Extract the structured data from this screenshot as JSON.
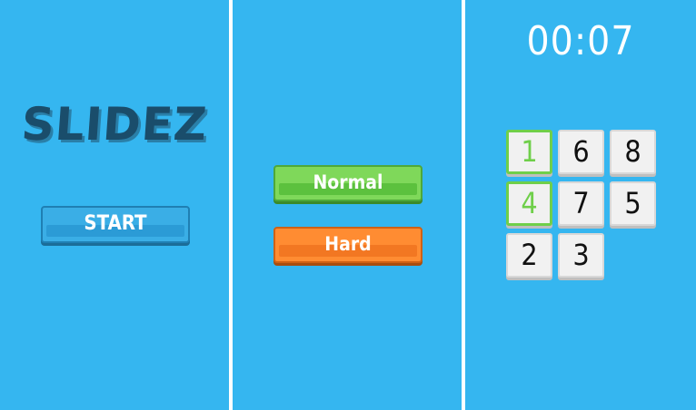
{
  "title_screen": {
    "logo": "SLIDEZ",
    "start_label": "START"
  },
  "difficulty_screen": {
    "normal_label": "Normal",
    "hard_label": "Hard"
  },
  "game_screen": {
    "timer": "00:07",
    "tiles": [
      {
        "label": "1",
        "state": "correct"
      },
      {
        "label": "6",
        "state": "normal"
      },
      {
        "label": "8",
        "state": "normal"
      },
      {
        "label": "4",
        "state": "correct"
      },
      {
        "label": "7",
        "state": "normal"
      },
      {
        "label": "5",
        "state": "normal"
      },
      {
        "label": "2",
        "state": "normal"
      },
      {
        "label": "3",
        "state": "normal"
      },
      {
        "label": "",
        "state": "empty"
      }
    ]
  },
  "colors": {
    "background": "#35b6f0",
    "logo": "#1a4d6b",
    "start_button": "#3aaee6",
    "normal_button": "#7fd85a",
    "hard_button": "#ff8c32",
    "correct_tile": "#6fcf4a"
  }
}
